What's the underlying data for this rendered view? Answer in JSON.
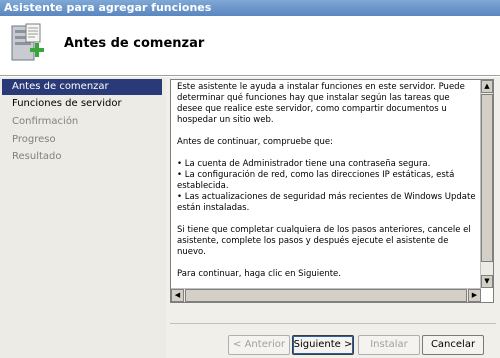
{
  "window": {
    "title": "Asistente para agregar funciones"
  },
  "header": {
    "title": "Antes de comenzar",
    "icon": "server-add-icon"
  },
  "nav": {
    "items": [
      {
        "label": "Antes de comenzar",
        "state": "active"
      },
      {
        "label": "Funciones de servidor",
        "state": "enabled"
      },
      {
        "label": "Confirmación",
        "state": "disabled"
      },
      {
        "label": "Progreso",
        "state": "disabled"
      },
      {
        "label": "Resultado",
        "state": "disabled"
      }
    ]
  },
  "content": {
    "paragraphs": [
      "Este asistente le ayuda a instalar funciones en este servidor. Puede determinar qué funciones hay que instalar según las tareas que desee que realice este servidor, como compartir documentos u hospedar un sitio web.",
      "Antes de continuar, compruebe que:",
      "• La cuenta de Administrador tiene una contraseña segura.\n• La configuración de red, como las direcciones IP estáticas, está establecida.\n• Las actualizaciones de seguridad más recientes de Windows Update están instaladas.",
      "Si tiene que completar cualquiera de los pasos anteriores, cancele el asistente, complete los pasos y después ejecute el asistente de nuevo.",
      "Para continuar, haga clic en Siguiente."
    ]
  },
  "buttons": {
    "previous": "< Anterior",
    "next": "Siguiente >",
    "install": "Instalar",
    "cancel": "Cancelar"
  }
}
